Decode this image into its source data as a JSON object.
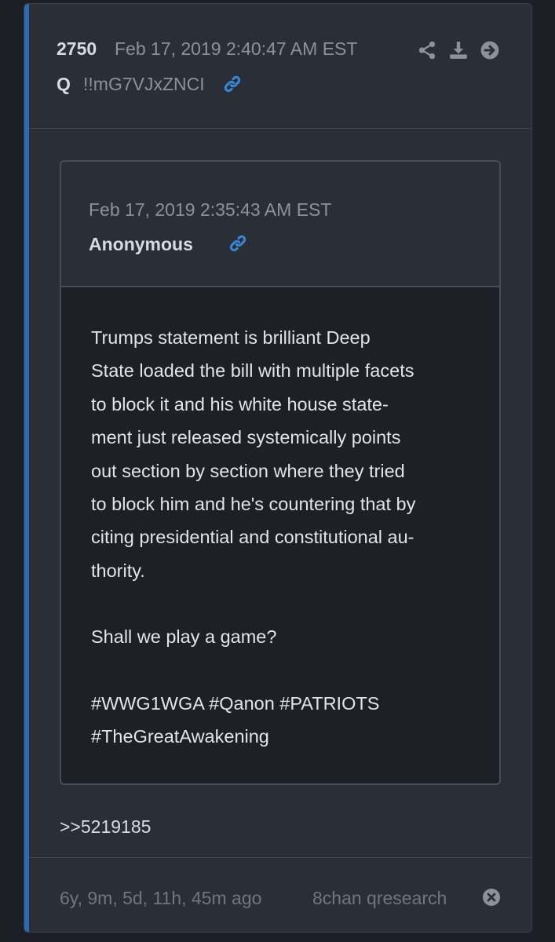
{
  "post": {
    "number": "2750",
    "datetime": "Feb 17, 2019 2:40:47 AM EST",
    "author": "Q",
    "tripcode": "!!mG7VJxZNCI"
  },
  "icons": {
    "link": "link-icon",
    "share": "share-icon",
    "download": "download-icon",
    "forward": "arrow-right-circle-icon",
    "close": "close-circle-icon"
  },
  "colors": {
    "accent": "#2d69b4",
    "link": "#3a86d6"
  },
  "quote": {
    "datetime": "Feb 17, 2019 2:35:43 AM EST",
    "author": "Anonymous",
    "paragraphs": [
      "Trumps statement is brilliant Deep\nState loaded the bill with multiple facets\nto block it and his white house state-\nment just released systemically points\nout section by section where they tried\nto block him and he's countering that by\nciting presidential and constitutional au-\nthority.",
      "Shall we play a game?",
      "#WWG1WGA #Qanon #PATRIOTS\n#TheGreatAwakening"
    ]
  },
  "reply_ref": ">>5219185",
  "footer": {
    "age": "6y, 9m, 5d, 11h, 45m ago",
    "board": "8chan qresearch"
  }
}
